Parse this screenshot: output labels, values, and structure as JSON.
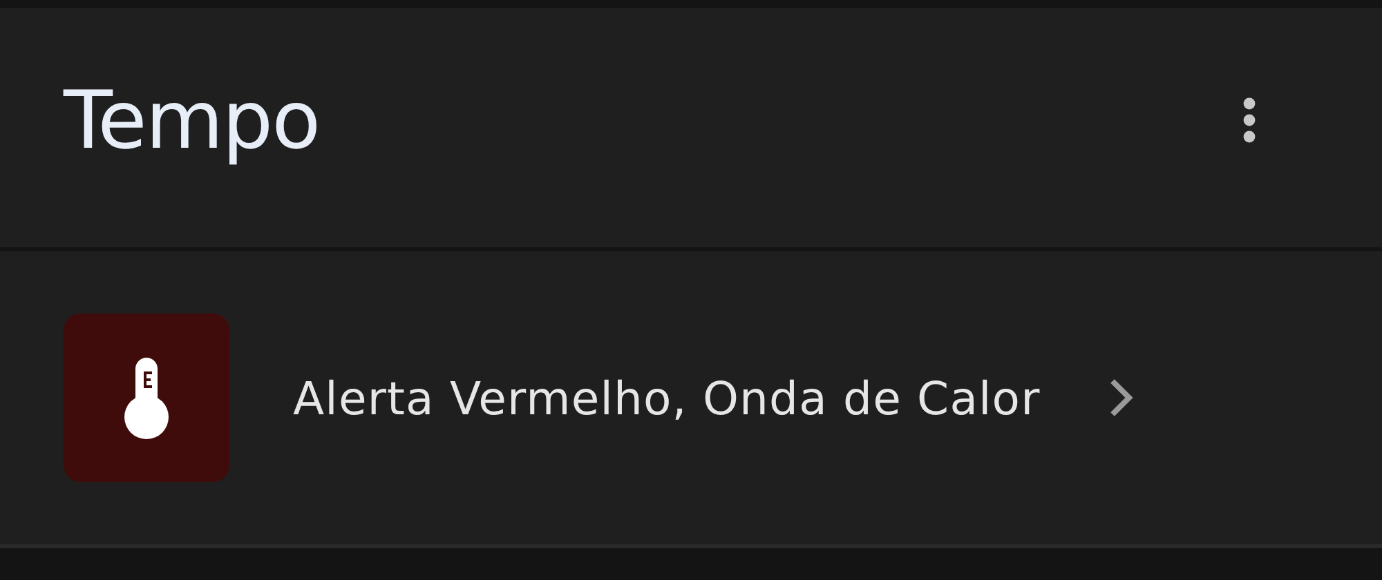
{
  "header": {
    "title": "Tempo"
  },
  "alerts": [
    {
      "title": "Alerta Vermelho, Onda de Calor",
      "color": "#3f0c0b"
    }
  ]
}
